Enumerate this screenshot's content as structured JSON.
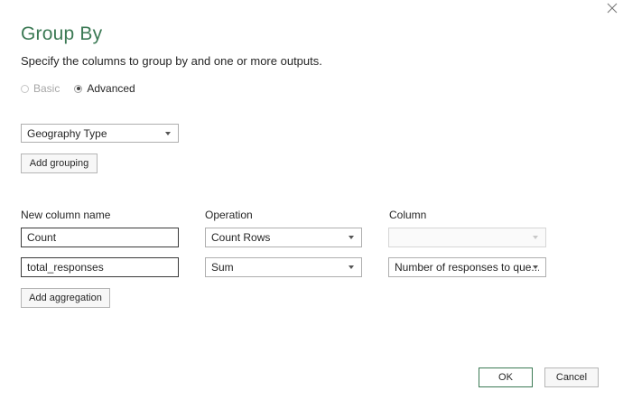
{
  "dialog": {
    "title": "Group By",
    "subtitle": "Specify the columns to group by and one or more outputs.",
    "close_icon": "close-icon"
  },
  "mode": {
    "basic_label": "Basic",
    "advanced_label": "Advanced",
    "selected": "Advanced"
  },
  "grouping": {
    "columns": [
      "Geography Type"
    ],
    "add_label": "Add grouping"
  },
  "aggregations": {
    "headers": {
      "name": "New column name",
      "operation": "Operation",
      "column": "Column"
    },
    "rows": [
      {
        "name": "Count",
        "operation": "Count Rows",
        "column": ""
      },
      {
        "name": "total_responses",
        "operation": "Sum",
        "column": "Number of responses to que..."
      }
    ],
    "add_label": "Add aggregation"
  },
  "footer": {
    "ok_label": "OK",
    "cancel_label": "Cancel"
  },
  "colors": {
    "title": "#3c7a55",
    "ok_border": "#3c7a55"
  }
}
